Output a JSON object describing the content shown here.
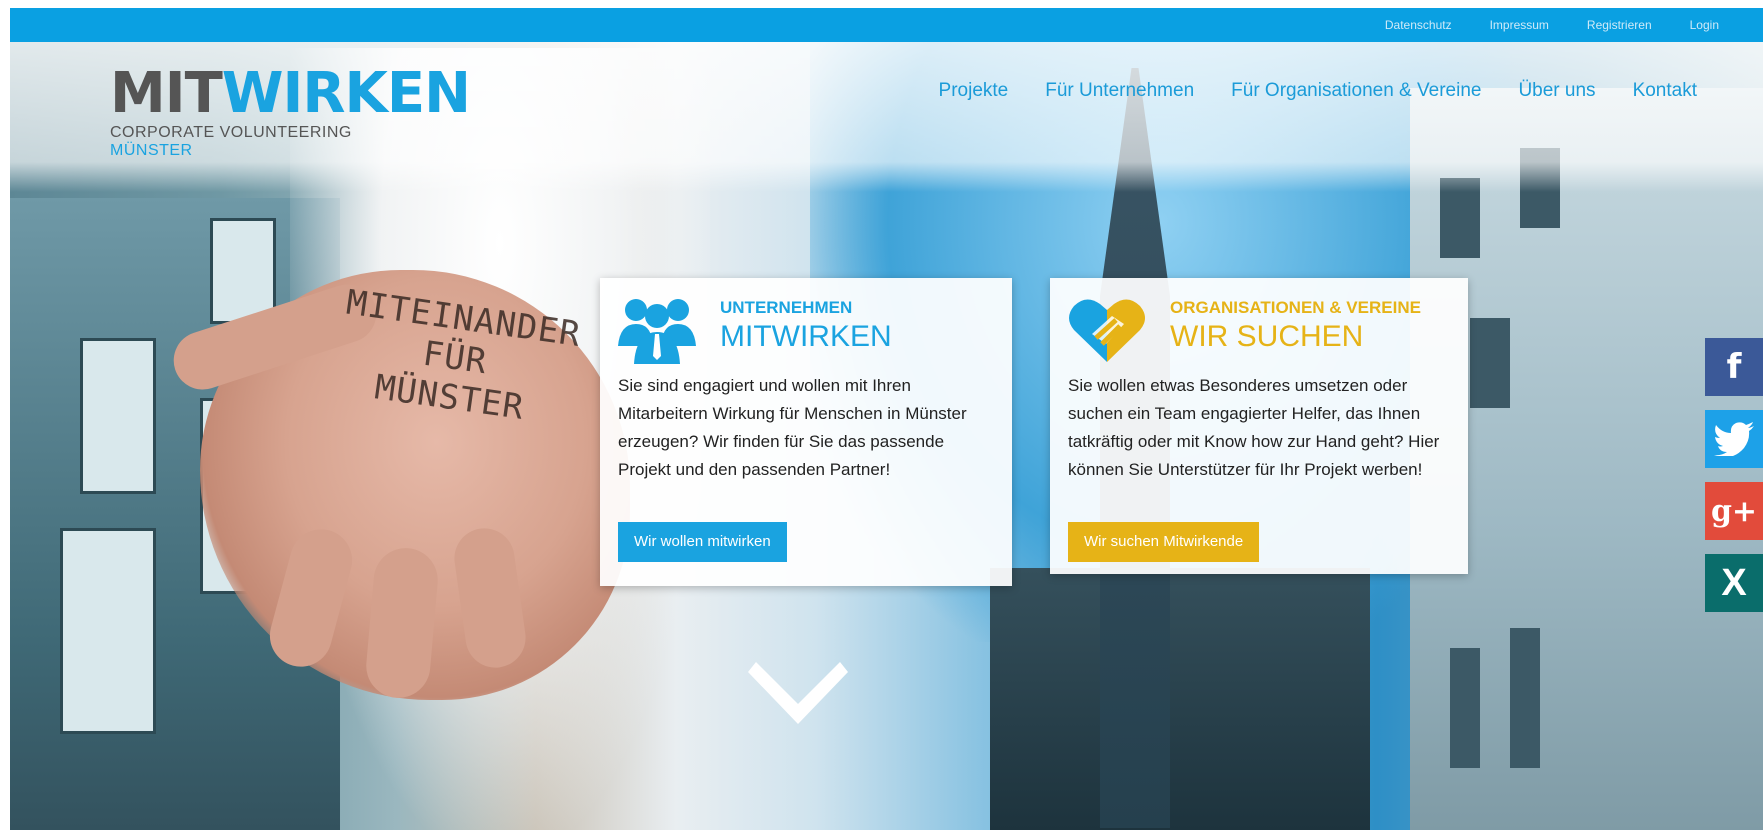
{
  "topbar": {
    "links": [
      "Datenschutz",
      "Impressum",
      "Registrieren",
      "Login"
    ]
  },
  "logo": {
    "main_left": "MIT",
    "main_right": "WIRKEN",
    "sub_left": "CORPORATE VOLUNTEERING ",
    "sub_right": "MÜNSTER"
  },
  "nav": {
    "items": [
      "Projekte",
      "Für Unternehmen",
      "Für Organisationen & Vereine",
      "Über uns",
      "Kontakt"
    ]
  },
  "hero": {
    "hand_text": [
      "MITEINANDER",
      "FÜR",
      "MÜNSTER"
    ]
  },
  "cards": [
    {
      "icon": "team-icon",
      "kicker": "UNTERNEHMEN",
      "title": "MITWIRKEN",
      "body": "Sie sind engagiert und wollen mit Ihren Mitarbeitern Wirkung für Menschen in Münster erzeugen? Wir finden für Sie das passende Projekt und den passenden Partner!",
      "button": "Wir wollen mitwirken",
      "accent": "#1aa3e0"
    },
    {
      "icon": "handshake-heart-icon",
      "kicker": "ORGANISATIONEN & VEREINE",
      "title": "WIR SUCHEN",
      "body": "Sie wollen etwas Besonderes umsetzen oder suchen ein Team engagierter Helfer, das Ihnen tatkräftig oder mit Know how zur Hand geht? Hier können Sie Unterstützer für Ihr Projekt werben!",
      "button": "Wir suchen Mitwirkende",
      "accent": "#e6b317"
    }
  ],
  "social": {
    "facebook": "f",
    "googleplus": "g+",
    "xing": "X"
  },
  "colors": {
    "topbar": "#0aa0e2",
    "brand_blue": "#1aa3e0",
    "brand_yellow": "#e6b317"
  }
}
